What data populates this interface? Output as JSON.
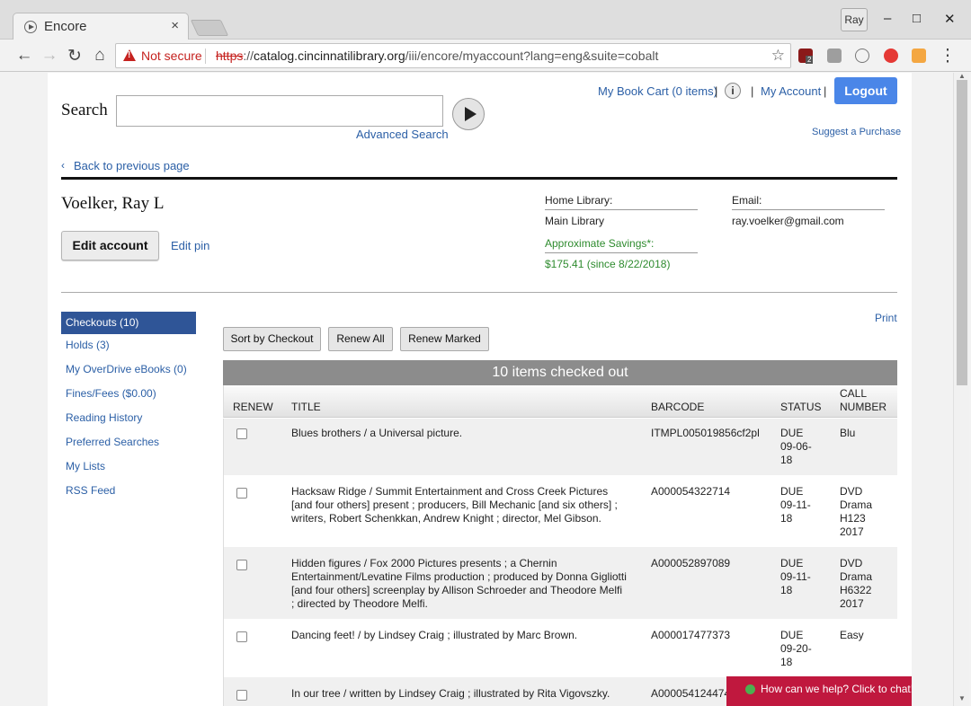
{
  "browser": {
    "tab_title": "Encore",
    "tab_close": "×",
    "profile": "Ray",
    "window_controls": {
      "minimize": "–",
      "maximize": "□",
      "close": "✕"
    },
    "security_label": "Not secure",
    "url_scheme": "https",
    "url_rest": "://",
    "url_host": "catalog.cincinnatilibrary.org",
    "url_path": "/iii/encore/myaccount?lang=eng&suite=cobalt",
    "bookmark_icon": "star-outline-icon",
    "ext_badge": "2"
  },
  "header": {
    "search_label": "Search",
    "search_value": "",
    "advanced_search": "Advanced Search",
    "book_cart": "My Book Cart (0 items)",
    "sep": "|",
    "info": "i",
    "my_account": "My Account",
    "logout": "Logout",
    "suggest": "Suggest a Purchase",
    "back_link": "Back to previous page"
  },
  "patron": {
    "name": "Voelker, Ray L",
    "edit_account": "Edit account",
    "edit_pin": "Edit pin",
    "home_library_label": "Home Library:",
    "home_library": "Main Library",
    "email_label": "Email:",
    "email": "ray.voelker@gmail.com",
    "savings_label": "Approximate Savings*:",
    "savings": "$175.41 (since 8/22/2018)"
  },
  "sidebar": {
    "items": [
      {
        "label": "Checkouts (10)",
        "active": true
      },
      {
        "label": "Holds (3)"
      },
      {
        "label": "My OverDrive eBooks (0)"
      },
      {
        "label": "Fines/Fees ($0.00)"
      },
      {
        "label": "Reading History"
      },
      {
        "label": "Preferred Searches"
      },
      {
        "label": "My Lists"
      },
      {
        "label": "RSS Feed"
      }
    ]
  },
  "checkouts": {
    "print": "Print",
    "sort_btn": "Sort by Checkout",
    "renew_all_btn": "Renew All",
    "renew_marked_btn": "Renew Marked",
    "title": "10 items checked out",
    "columns": {
      "renew": "RENEW",
      "title": "TITLE",
      "barcode": "BARCODE",
      "status": "STATUS",
      "call_l1": "CALL",
      "call_l2": "NUMBER"
    },
    "rows": [
      {
        "title": [
          "Blues brothers / a Universal picture."
        ],
        "barcode": "ITMPL005019856cf2pl",
        "status": [
          "DUE",
          "09-06-",
          "18"
        ],
        "call": [
          "Blu"
        ]
      },
      {
        "title": [
          "Hacksaw Ridge / Summit Entertainment and Cross Creek Pictures",
          "[and four others] present ; producers, Bill Mechanic [and six others] ;",
          "writers, Robert Schenkkan, Andrew Knight ; director, Mel Gibson."
        ],
        "barcode": "A000054322714",
        "status": [
          "DUE",
          "09-11-",
          "18"
        ],
        "call": [
          "DVD",
          "Drama",
          "H123",
          "2017"
        ]
      },
      {
        "title": [
          "Hidden figures / Fox 2000 Pictures presents ; a Chernin",
          "Entertainment/Levatine Films production ; produced by Donna Gigliotti",
          "[and four others] screenplay by Allison Schroeder and Theodore Melfi",
          "; directed by Theodore Melfi."
        ],
        "barcode": "A000052897089",
        "status": [
          "DUE",
          "09-11-",
          "18"
        ],
        "call": [
          "DVD",
          "Drama",
          "H6322",
          "2017"
        ]
      },
      {
        "title": [
          "Dancing feet! / by Lindsey Craig ; illustrated by Marc Brown."
        ],
        "barcode": "A000017477373",
        "status": [
          "DUE",
          "09-20-",
          "18"
        ],
        "call": [
          "Easy"
        ]
      },
      {
        "title": [
          "In our tree / written by Lindsey Craig ; illustrated by Rita Vigovszky."
        ],
        "barcode": "A000054124474",
        "status": [],
        "call": []
      }
    ]
  },
  "chat": {
    "label": "How can we help? Click to chat!"
  }
}
